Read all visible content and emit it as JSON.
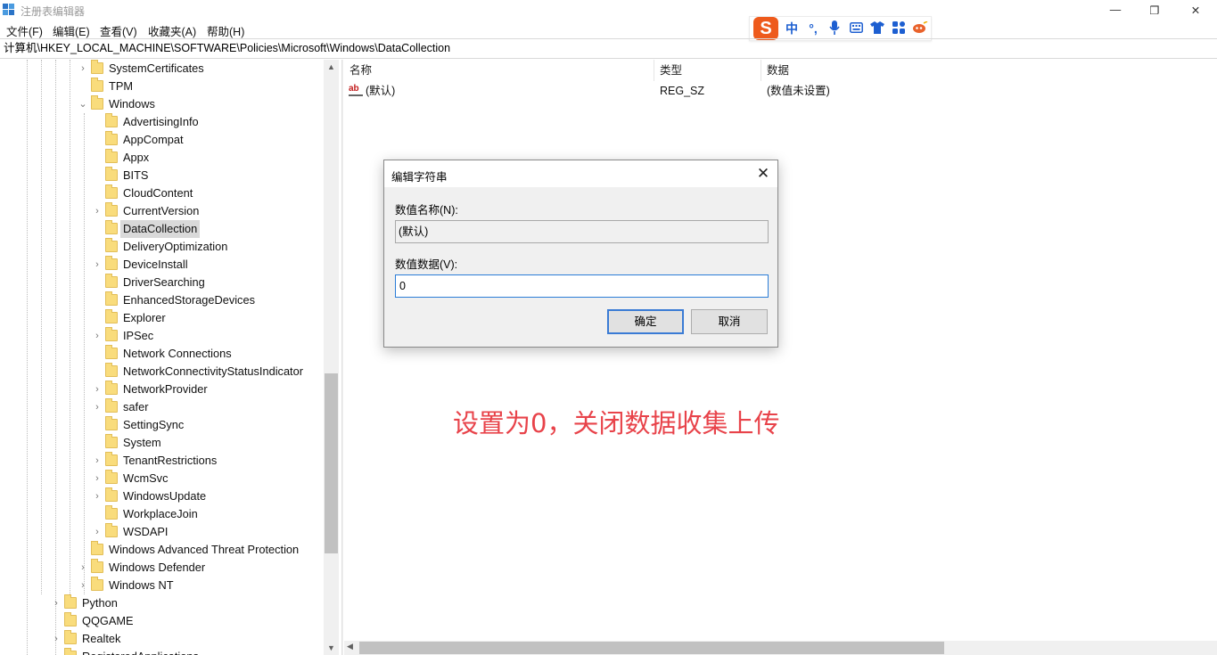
{
  "window": {
    "title": "注册表编辑器",
    "minimize_glyph": "—",
    "restore_glyph": "❐",
    "close_glyph": "✕"
  },
  "menu": [
    "文件(F)",
    "编辑(E)",
    "查看(V)",
    "收藏夹(A)",
    "帮助(H)"
  ],
  "ime": {
    "logo": "S",
    "mode": "中",
    "punct": "°,",
    "icons": [
      "mic-icon",
      "keyboard-icon",
      "shirt-icon",
      "grid-icon",
      "tool-icon"
    ]
  },
  "address": "计算机\\HKEY_LOCAL_MACHINE\\SOFTWARE\\Policies\\Microsoft\\Windows\\DataCollection",
  "tree": [
    {
      "label": "SystemCertificates",
      "level": 2,
      "expander": "›",
      "selected": false
    },
    {
      "label": "TPM",
      "level": 2,
      "expander": "",
      "selected": false
    },
    {
      "label": "Windows",
      "level": 2,
      "expander": "⌄",
      "selected": false
    },
    {
      "label": "AdvertisingInfo",
      "level": 3,
      "expander": "",
      "selected": false
    },
    {
      "label": "AppCompat",
      "level": 3,
      "expander": "",
      "selected": false
    },
    {
      "label": "Appx",
      "level": 3,
      "expander": "",
      "selected": false
    },
    {
      "label": "BITS",
      "level": 3,
      "expander": "",
      "selected": false
    },
    {
      "label": "CloudContent",
      "level": 3,
      "expander": "",
      "selected": false
    },
    {
      "label": "CurrentVersion",
      "level": 3,
      "expander": "›",
      "selected": false
    },
    {
      "label": "DataCollection",
      "level": 3,
      "expander": "",
      "selected": true
    },
    {
      "label": "DeliveryOptimization",
      "level": 3,
      "expander": "",
      "selected": false
    },
    {
      "label": "DeviceInstall",
      "level": 3,
      "expander": "›",
      "selected": false
    },
    {
      "label": "DriverSearching",
      "level": 3,
      "expander": "",
      "selected": false
    },
    {
      "label": "EnhancedStorageDevices",
      "level": 3,
      "expander": "",
      "selected": false
    },
    {
      "label": "Explorer",
      "level": 3,
      "expander": "",
      "selected": false
    },
    {
      "label": "IPSec",
      "level": 3,
      "expander": "›",
      "selected": false
    },
    {
      "label": "Network Connections",
      "level": 3,
      "expander": "",
      "selected": false
    },
    {
      "label": "NetworkConnectivityStatusIndicator",
      "level": 3,
      "expander": "",
      "selected": false
    },
    {
      "label": "NetworkProvider",
      "level": 3,
      "expander": "›",
      "selected": false
    },
    {
      "label": "safer",
      "level": 3,
      "expander": "›",
      "selected": false
    },
    {
      "label": "SettingSync",
      "level": 3,
      "expander": "",
      "selected": false
    },
    {
      "label": "System",
      "level": 3,
      "expander": "",
      "selected": false
    },
    {
      "label": "TenantRestrictions",
      "level": 3,
      "expander": "›",
      "selected": false
    },
    {
      "label": "WcmSvc",
      "level": 3,
      "expander": "›",
      "selected": false
    },
    {
      "label": "WindowsUpdate",
      "level": 3,
      "expander": "›",
      "selected": false
    },
    {
      "label": "WorkplaceJoin",
      "level": 3,
      "expander": "",
      "selected": false
    },
    {
      "label": "WSDAPI",
      "level": 3,
      "expander": "›",
      "selected": false
    },
    {
      "label": "Windows Advanced Threat Protection",
      "level": 2,
      "expander": "",
      "selected": false
    },
    {
      "label": "Windows Defender",
      "level": 2,
      "expander": "›",
      "selected": false
    },
    {
      "label": "Windows NT",
      "level": 2,
      "expander": "›",
      "selected": false
    },
    {
      "label": "Python",
      "level": 0,
      "expander": "›",
      "selected": false
    },
    {
      "label": "QQGAME",
      "level": 0,
      "expander": "",
      "selected": false
    },
    {
      "label": "Realtek",
      "level": 0,
      "expander": "›",
      "selected": false
    },
    {
      "label": "RegisteredApplications",
      "level": 0,
      "expander": "",
      "selected": false
    }
  ],
  "values_pane": {
    "columns": [
      "名称",
      "类型",
      "数据"
    ],
    "rows": [
      {
        "icon": "ab",
        "name": "(默认)",
        "type": "REG_SZ",
        "data": "(数值未设置)"
      }
    ]
  },
  "annotation": "设置为0，关闭数据收集上传",
  "dialog": {
    "title": "编辑字符串",
    "close_glyph": "✕",
    "name_label": "数值名称(N):",
    "name_value": "(默认)",
    "data_label": "数值数据(V):",
    "data_value": "0",
    "ok": "确定",
    "cancel": "取消"
  },
  "scroll": {
    "up": "▲",
    "down": "▼",
    "left": "◀",
    "right": "▶"
  }
}
